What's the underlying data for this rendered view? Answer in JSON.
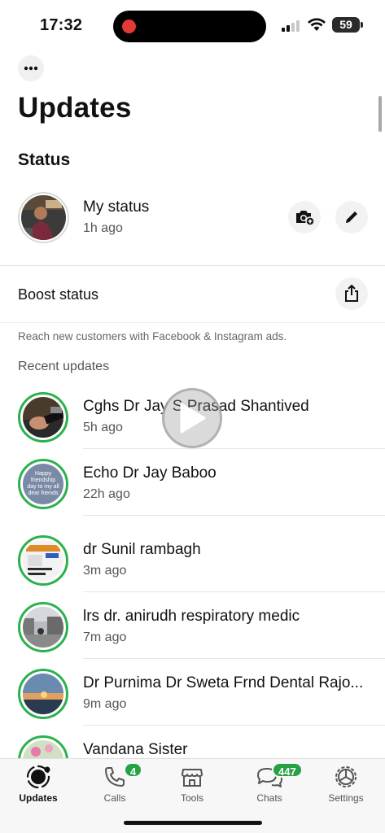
{
  "status_bar": {
    "time": "17:32",
    "battery": "59"
  },
  "header": {
    "more_icon": "ellipsis-icon",
    "title": "Updates"
  },
  "status_section": {
    "title": "Status",
    "my_status": {
      "name": "My status",
      "time": "1h ago"
    }
  },
  "boost": {
    "label": "Boost status",
    "note": "Reach new customers with Facebook & Instagram ads."
  },
  "recent": {
    "title": "Recent updates",
    "items": [
      {
        "name": "Cghs Dr Jay S Prasad Shantived",
        "time": "5h ago"
      },
      {
        "name": "Echo Dr Jay Baboo",
        "time": "22h ago",
        "thumb_text": "Happy friendship day to my all dear friends"
      },
      {
        "name": "dr Sunil rambagh",
        "time": "3m ago"
      },
      {
        "name": "lrs dr. anirudh respiratory medic",
        "time": "7m ago"
      },
      {
        "name": "Dr Purnima Dr Sweta Frnd Dental Rajo...",
        "time": "9m ago"
      },
      {
        "name": "Vandana Sister",
        "time": ""
      }
    ]
  },
  "tabs": [
    {
      "label": "Updates",
      "icon": "updates-icon",
      "active": true
    },
    {
      "label": "Calls",
      "icon": "phone-icon",
      "badge": "4"
    },
    {
      "label": "Tools",
      "icon": "storefront-icon"
    },
    {
      "label": "Chats",
      "icon": "chat-bubbles-icon",
      "badge": "447"
    },
    {
      "label": "Settings",
      "icon": "gear-icon"
    }
  ],
  "colors": {
    "accent": "#25a244",
    "ring": "#2bb24c"
  }
}
